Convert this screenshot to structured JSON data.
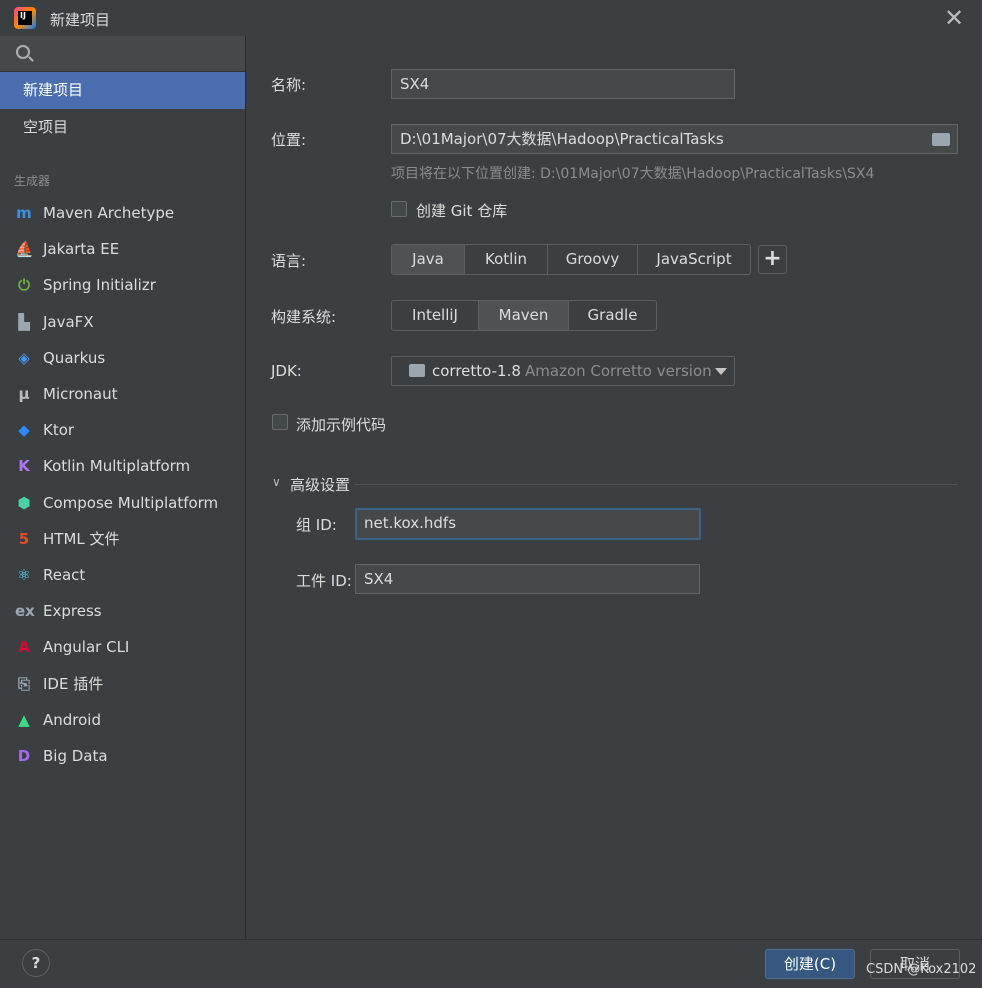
{
  "window": {
    "title": "新建项目",
    "app_icon_letters": "IJ"
  },
  "sidebar": {
    "search_placeholder": "",
    "top_items": [
      {
        "label": "新建项目",
        "selected": true
      },
      {
        "label": "空项目",
        "selected": false
      }
    ],
    "generators_label": "生成器",
    "generators": [
      {
        "label": "Maven Archetype",
        "icon": "maven-icon",
        "glyph": "m",
        "color": "#3d8fe0"
      },
      {
        "label": "Jakarta EE",
        "icon": "jakarta-ee-icon",
        "glyph": "⛵",
        "color": "#f0a732"
      },
      {
        "label": "Spring Initializr",
        "icon": "spring-icon",
        "glyph": "⏻",
        "color": "#6db33f"
      },
      {
        "label": "JavaFX",
        "icon": "javafx-icon",
        "glyph": "▙",
        "color": "#9aa7b0"
      },
      {
        "label": "Quarkus",
        "icon": "quarkus-icon",
        "glyph": "◈",
        "color": "#4695eb"
      },
      {
        "label": "Micronaut",
        "icon": "micronaut-icon",
        "glyph": "μ",
        "color": "#bbbbbb"
      },
      {
        "label": "Ktor",
        "icon": "ktor-icon",
        "glyph": "◆",
        "color": "#2f88ff"
      },
      {
        "label": "Kotlin Multiplatform",
        "icon": "kotlin-icon",
        "glyph": "K",
        "color": "#b075f0"
      },
      {
        "label": "Compose Multiplatform",
        "icon": "compose-icon",
        "glyph": "⬢",
        "color": "#4dd0a8"
      },
      {
        "label": "HTML 文件",
        "icon": "html5-icon",
        "glyph": "5",
        "color": "#e44d26"
      },
      {
        "label": "React",
        "icon": "react-icon",
        "glyph": "⚛",
        "color": "#61dafb"
      },
      {
        "label": "Express",
        "icon": "express-icon",
        "glyph": "ex",
        "color": "#9aa7b0"
      },
      {
        "label": "Angular CLI",
        "icon": "angular-icon",
        "glyph": "A",
        "color": "#dd0031"
      },
      {
        "label": "IDE 插件",
        "icon": "plugin-icon",
        "glyph": "⎘",
        "color": "#9aa7b0"
      },
      {
        "label": "Android",
        "icon": "android-icon",
        "glyph": "▲",
        "color": "#3ddc84"
      },
      {
        "label": "Big Data",
        "icon": "bigdata-icon",
        "glyph": "D",
        "color": "#a36bf2"
      }
    ]
  },
  "form": {
    "name_label": "名称:",
    "name_value": "SX4",
    "location_label": "位置:",
    "location_value": "D:\\01Major\\07大数据\\Hadoop\\PracticalTasks",
    "location_hint": "项目将在以下位置创建: D:\\01Major\\07大数据\\Hadoop\\PracticalTasks\\SX4",
    "git_checkbox_label": "创建 Git 仓库",
    "language_label": "语言:",
    "languages": [
      "Java",
      "Kotlin",
      "Groovy",
      "JavaScript"
    ],
    "language_selected": "Java",
    "build_label": "构建系统:",
    "build_systems": [
      "IntelliJ",
      "Maven",
      "Gradle"
    ],
    "build_selected": "Maven",
    "jdk_label": "JDK:",
    "jdk_value": "corretto-1.8",
    "jdk_detail": "Amazon Corretto version",
    "sample_code_label": "添加示例代码",
    "advanced_label": "高级设置",
    "group_id_label": "组 ID:",
    "group_id_value": "net.kox.hdfs",
    "artifact_id_label": "工件 ID:",
    "artifact_id_value": "SX4"
  },
  "footer": {
    "help_label": "?",
    "create_label": "创建(C)",
    "cancel_label": "取消"
  },
  "watermark": "CSDN @Kox2102",
  "colors": {
    "selection": "#4b6eaf",
    "primary_button": "#365880",
    "focus_border": "#3d6185"
  }
}
